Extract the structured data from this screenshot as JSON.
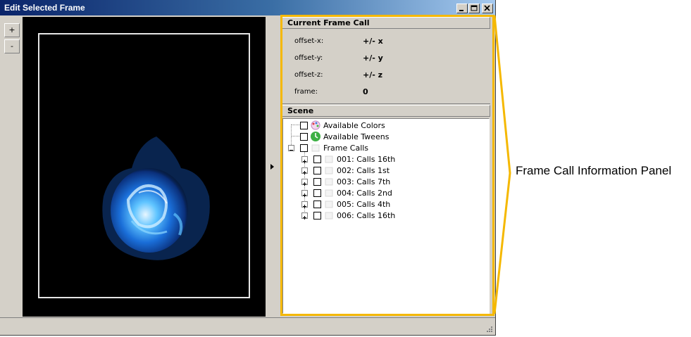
{
  "window": {
    "title": "Edit Selected Frame",
    "controls": [
      "minimize-icon",
      "maximize-icon",
      "close-icon"
    ]
  },
  "toolbar": {
    "zoom_in_label": "+",
    "zoom_out_label": "-"
  },
  "current_frame_call": {
    "heading": "Current Frame Call",
    "rows": [
      {
        "label": "offset-x:",
        "value": "+/- x"
      },
      {
        "label": "offset-y:",
        "value": "+/- y"
      },
      {
        "label": "offset-z:",
        "value": "+/- z"
      },
      {
        "label": "frame:",
        "value": "0"
      }
    ]
  },
  "scene": {
    "heading": "Scene",
    "roots": [
      {
        "label": "Available Colors",
        "icon": "palette-icon"
      },
      {
        "label": "Available Tweens",
        "icon": "tween-icon"
      },
      {
        "label": "Frame Calls",
        "icon": "frame-icon"
      }
    ],
    "frame_calls": [
      "001: Calls 16th",
      "002: Calls 1st",
      "003: Calls 7th",
      "004: Calls 2nd",
      "005: Calls 4th",
      "006: Calls 16th"
    ]
  },
  "annotation": {
    "label": "Frame Call Information Panel",
    "color": "#f5b800"
  },
  "colors": {
    "titlebar_start": "#0a246a",
    "titlebar_end": "#a6caf0",
    "panel_bg": "#d4d0c8",
    "preview_bg": "#000000"
  }
}
